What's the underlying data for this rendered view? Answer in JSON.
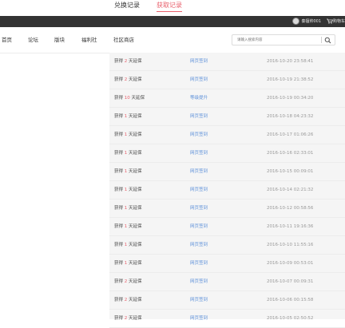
{
  "tabs": {
    "exchange": "兑换记录",
    "obtain": "获取记录"
  },
  "topbar": {
    "username": "秦擅帅001",
    "cart_label": "购物车"
  },
  "nav": {
    "home": "首页",
    "forum": "论坛",
    "section": "版块",
    "welfare": "福利社",
    "store": "社区商店"
  },
  "search": {
    "placeholder": "请输入搜索内容"
  },
  "records": [
    {
      "prefix": "获得 ",
      "num": "2",
      "suffix": " 天延保",
      "source": "网页签到",
      "time": "2016-10-20 23:58:41"
    },
    {
      "prefix": "获得 ",
      "num": "2",
      "suffix": " 天延保",
      "source": "网页签到",
      "time": "2016-10-19 21:38:52"
    },
    {
      "prefix": "获得 ",
      "num": "10",
      "suffix": " 天延保",
      "source": "等级提升",
      "time": "2016-10-19 00:34:20"
    },
    {
      "prefix": "获得 ",
      "num": "1",
      "suffix": " 天延保",
      "source": "网页签到",
      "time": "2016-10-18 04:23:32"
    },
    {
      "prefix": "获得 ",
      "num": "1",
      "suffix": " 天延保",
      "source": "网页签到",
      "time": "2016-10-17 01:06:26"
    },
    {
      "prefix": "获得 ",
      "num": "1",
      "suffix": " 天延保",
      "source": "网页签到",
      "time": "2016-10-16 02:33:01"
    },
    {
      "prefix": "获得 ",
      "num": "1",
      "suffix": " 天延保",
      "source": "网页签到",
      "time": "2016-10-15 00:09:01"
    },
    {
      "prefix": "获得 ",
      "num": "1",
      "suffix": " 天延保",
      "source": "网页签到",
      "time": "2016-10-14 02:21:32"
    },
    {
      "prefix": "获得 ",
      "num": "1",
      "suffix": " 天延保",
      "source": "网页签到",
      "time": "2016-10-12 00:58:56"
    },
    {
      "prefix": "获得 ",
      "num": "1",
      "suffix": " 天延保",
      "source": "网页签到",
      "time": "2016-10-11 19:16:36"
    },
    {
      "prefix": "获得 ",
      "num": "1",
      "suffix": " 天延保",
      "source": "网页签到",
      "time": "2016-10-10 11:55:16"
    },
    {
      "prefix": "获得 ",
      "num": "1",
      "suffix": " 天延保",
      "source": "网页签到",
      "time": "2016-10-09 00:53:01"
    },
    {
      "prefix": "获得 ",
      "num": "2",
      "suffix": " 天延保",
      "source": "网页签到",
      "time": "2016-10-07 00:09:31"
    },
    {
      "prefix": "获得 ",
      "num": "2",
      "suffix": " 天延保",
      "source": "网页签到",
      "time": "2016-10-06 00:15:58"
    },
    {
      "prefix": "获得 ",
      "num": "2",
      "suffix": " 天延保",
      "source": "网页签到",
      "time": "2016-10-05 02:50:52"
    }
  ],
  "colors": {
    "accent": "#e8606c",
    "link": "#5b8fd9",
    "topbar": "#333333"
  }
}
